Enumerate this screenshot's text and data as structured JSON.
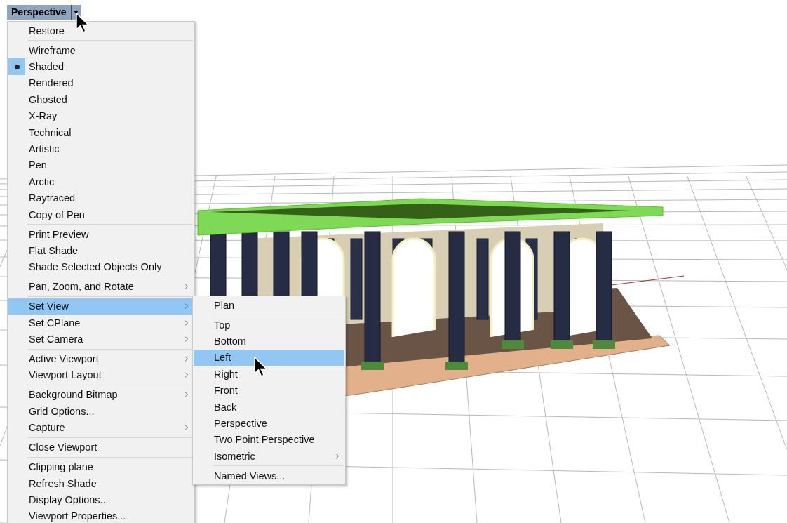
{
  "viewport_tab": {
    "label": "Perspective"
  },
  "menu": {
    "items": [
      {
        "kind": "item",
        "label": "Restore",
        "checked": false,
        "selected": false,
        "submenu": false
      },
      {
        "kind": "separator"
      },
      {
        "kind": "item",
        "label": "Wireframe",
        "checked": false,
        "selected": false,
        "submenu": false
      },
      {
        "kind": "item",
        "label": "Shaded",
        "checked": true,
        "selected": false,
        "submenu": false
      },
      {
        "kind": "item",
        "label": "Rendered",
        "checked": false,
        "selected": false,
        "submenu": false
      },
      {
        "kind": "item",
        "label": "Ghosted",
        "checked": false,
        "selected": false,
        "submenu": false
      },
      {
        "kind": "item",
        "label": "X-Ray",
        "checked": false,
        "selected": false,
        "submenu": false
      },
      {
        "kind": "item",
        "label": "Technical",
        "checked": false,
        "selected": false,
        "submenu": false
      },
      {
        "kind": "item",
        "label": "Artistic",
        "checked": false,
        "selected": false,
        "submenu": false
      },
      {
        "kind": "item",
        "label": "Pen",
        "checked": false,
        "selected": false,
        "submenu": false
      },
      {
        "kind": "item",
        "label": "Arctic",
        "checked": false,
        "selected": false,
        "submenu": false
      },
      {
        "kind": "item",
        "label": "Raytraced",
        "checked": false,
        "selected": false,
        "submenu": false
      },
      {
        "kind": "item",
        "label": "Copy of Pen",
        "checked": false,
        "selected": false,
        "submenu": false
      },
      {
        "kind": "separator"
      },
      {
        "kind": "item",
        "label": "Print Preview",
        "checked": false,
        "selected": false,
        "submenu": false
      },
      {
        "kind": "item",
        "label": "Flat Shade",
        "checked": false,
        "selected": false,
        "submenu": false
      },
      {
        "kind": "item",
        "label": "Shade Selected Objects Only",
        "checked": false,
        "selected": false,
        "submenu": false
      },
      {
        "kind": "separator"
      },
      {
        "kind": "item",
        "label": "Pan, Zoom, and Rotate",
        "checked": false,
        "selected": false,
        "submenu": true
      },
      {
        "kind": "separator"
      },
      {
        "kind": "item",
        "label": "Set View",
        "checked": false,
        "selected": true,
        "submenu": true
      },
      {
        "kind": "item",
        "label": "Set CPlane",
        "checked": false,
        "selected": false,
        "submenu": true
      },
      {
        "kind": "item",
        "label": "Set Camera",
        "checked": false,
        "selected": false,
        "submenu": true
      },
      {
        "kind": "separator"
      },
      {
        "kind": "item",
        "label": "Active Viewport",
        "checked": false,
        "selected": false,
        "submenu": true
      },
      {
        "kind": "item",
        "label": "Viewport Layout",
        "checked": false,
        "selected": false,
        "submenu": true
      },
      {
        "kind": "separator"
      },
      {
        "kind": "item",
        "label": "Background Bitmap",
        "checked": false,
        "selected": false,
        "submenu": true
      },
      {
        "kind": "item",
        "label": "Grid Options...",
        "checked": false,
        "selected": false,
        "submenu": false
      },
      {
        "kind": "item",
        "label": "Capture",
        "checked": false,
        "selected": false,
        "submenu": true
      },
      {
        "kind": "separator"
      },
      {
        "kind": "item",
        "label": "Close Viewport",
        "checked": false,
        "selected": false,
        "submenu": false
      },
      {
        "kind": "separator"
      },
      {
        "kind": "item",
        "label": "Clipping plane",
        "checked": false,
        "selected": false,
        "submenu": false
      },
      {
        "kind": "item",
        "label": "Refresh Shade",
        "checked": false,
        "selected": false,
        "submenu": false
      },
      {
        "kind": "item",
        "label": "Display Options...",
        "checked": false,
        "selected": false,
        "submenu": false
      },
      {
        "kind": "item",
        "label": "Viewport Properties...",
        "checked": false,
        "selected": false,
        "submenu": false
      }
    ]
  },
  "submenu": {
    "items": [
      {
        "kind": "item",
        "label": "Plan",
        "selected": false,
        "submenu": false
      },
      {
        "kind": "separator"
      },
      {
        "kind": "item",
        "label": "Top",
        "selected": false,
        "submenu": false
      },
      {
        "kind": "item",
        "label": "Bottom",
        "selected": false,
        "submenu": false
      },
      {
        "kind": "item",
        "label": "Left",
        "selected": true,
        "submenu": false
      },
      {
        "kind": "item",
        "label": "Right",
        "selected": false,
        "submenu": false
      },
      {
        "kind": "item",
        "label": "Front",
        "selected": false,
        "submenu": false
      },
      {
        "kind": "item",
        "label": "Back",
        "selected": false,
        "submenu": false
      },
      {
        "kind": "item",
        "label": "Perspective",
        "selected": false,
        "submenu": false
      },
      {
        "kind": "item",
        "label": "Two Point Perspective",
        "selected": false,
        "submenu": false
      },
      {
        "kind": "item",
        "label": "Isometric",
        "selected": false,
        "submenu": true
      },
      {
        "kind": "separator"
      },
      {
        "kind": "item",
        "label": "Named Views...",
        "selected": false,
        "submenu": false
      }
    ]
  }
}
